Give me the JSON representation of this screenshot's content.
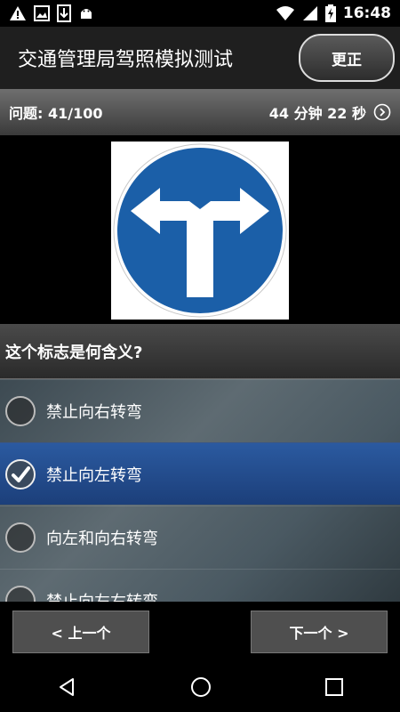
{
  "status_bar": {
    "time": "16:48",
    "left_icons": [
      "warning-icon",
      "image-icon",
      "download-icon",
      "android-icon"
    ],
    "right_icons": [
      "wifi-icon",
      "signal-icon",
      "battery-charging-icon"
    ]
  },
  "app_bar": {
    "title": "交通管理局驾照模拟测试",
    "correct_button_label": "更正"
  },
  "progress": {
    "question_counter": "问题: 41/100",
    "time_remaining": "44 分钟 22 秒"
  },
  "question": {
    "image_icon": "mandatory-turn-left-or-right-sign",
    "sign_color": "#1b5fa8",
    "text": "这个标志是何含义?"
  },
  "options": [
    {
      "label": "禁止向右转弯",
      "selected": false
    },
    {
      "label": "禁止向左转弯",
      "selected": true
    },
    {
      "label": "向左和向右转弯",
      "selected": false
    },
    {
      "label": "禁止向左右转弯",
      "selected": false
    }
  ],
  "navigation": {
    "prev_label": "< 上一个",
    "next_label": "下一个 >"
  },
  "colors": {
    "selected_option": "#2b5aa0",
    "app_bar": "#1f1f1f"
  }
}
